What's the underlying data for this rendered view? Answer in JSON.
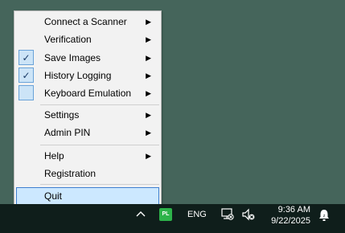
{
  "menu": {
    "items": [
      {
        "label": "Connect a Scanner",
        "submenu": true
      },
      {
        "label": "Verification",
        "submenu": true
      },
      {
        "label": "Save Images",
        "submenu": true,
        "checked": true
      },
      {
        "label": "History Logging",
        "submenu": true,
        "checked": true
      },
      {
        "label": "Keyboard Emulation",
        "submenu": true,
        "checked": false
      },
      {
        "label": "Settings",
        "submenu": true
      },
      {
        "label": "Admin PIN",
        "submenu": true
      },
      {
        "label": "Help",
        "submenu": true
      },
      {
        "label": "Registration",
        "submenu": false
      },
      {
        "label": "Quit",
        "submenu": false,
        "highlighted": true
      }
    ],
    "check_glyph": "✓",
    "arrow_glyph": "▶"
  },
  "taskbar": {
    "chevron": "^",
    "app_icon_text": "PL",
    "language": "ENG",
    "time": "9:36 AM",
    "date": "9/22/2025",
    "icons": [
      "chevron-up-icon",
      "pl-app-icon",
      "network-icon",
      "volume-muted-icon",
      "notification-bell-icon"
    ]
  },
  "colors": {
    "desktop": "#45655b",
    "menu_bg": "#f2f2f2",
    "selection_bg": "#cce8ff",
    "selection_border": "#3f7fcf",
    "taskbar_bg": "#0f1e1b",
    "app_icon_bg": "#2db34a"
  }
}
